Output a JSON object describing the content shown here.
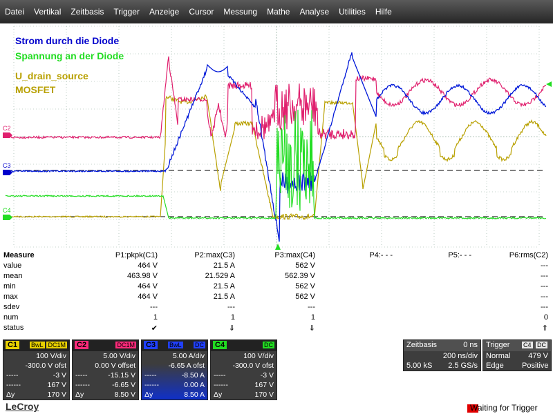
{
  "menu": [
    "Datei",
    "Vertikal",
    "Zeitbasis",
    "Trigger",
    "Anzeige",
    "Cursor",
    "Messung",
    "Mathe",
    "Analyse",
    "Utilities",
    "Hilfe"
  ],
  "legend": [
    {
      "text": "Strom durch die Diode",
      "color": "#0000cc"
    },
    {
      "text": "Spannung an der Diode",
      "color": "#22dd22"
    },
    {
      "text": "U_drain_source",
      "color": "#b8a000"
    },
    {
      "text": "MOSFET",
      "color": "#b8a000"
    }
  ],
  "channel_markers": [
    {
      "label": "C2",
      "color": "#e0206e"
    },
    {
      "label": "C3",
      "color": "#0000cc"
    },
    {
      "label": "C4",
      "color": "#22dd22"
    }
  ],
  "trigger_marker_color": "#22dd22",
  "colors": {
    "c1": "#b8a000",
    "c2": "#e0206e",
    "c3": "#0018d8",
    "c4": "#22dd22",
    "grid": "#7a9a8a"
  },
  "measure": {
    "header": [
      "Measure",
      "P1:pkpk(C1)",
      "P2:max(C3)",
      "P3:max(C4)",
      "P4:- - -",
      "P5:- - -",
      "P6:rms(C2)"
    ],
    "rows": [
      [
        "value",
        "464 V",
        "21.5 A",
        "562 V",
        "",
        "",
        "---"
      ],
      [
        "mean",
        "463.98 V",
        "21.529 A",
        "562.39 V",
        "",
        "",
        "---"
      ],
      [
        "min",
        "464 V",
        "21.5 A",
        "562 V",
        "",
        "",
        "---"
      ],
      [
        "max",
        "464 V",
        "21.5 A",
        "562 V",
        "",
        "",
        "---"
      ],
      [
        "sdev",
        "---",
        "---",
        "---",
        "",
        "",
        "---"
      ],
      [
        "num",
        "1",
        "1",
        "1",
        "",
        "",
        "0"
      ],
      [
        "status",
        "✔",
        "⇓",
        "⇓",
        "",
        "",
        "⇑"
      ]
    ]
  },
  "channels": [
    {
      "id": "C1",
      "badge1": "BwL",
      "badge2": "DC1M",
      "color": "#e8d000",
      "line1": "100 V/div",
      "line2": "-300.0 V ofst",
      "line3": [
        "-----",
        "-3 V"
      ],
      "line4": [
        "------",
        "167 V"
      ],
      "line5": [
        "Δy",
        "170 V"
      ]
    },
    {
      "id": "C2",
      "badge1": "",
      "badge2": "DC1M",
      "color": "#ff2a7a",
      "line1": "5.00 V/div",
      "line2": "0.00 V offset",
      "line3": [
        "-----",
        "-15.15 V"
      ],
      "line4": [
        "------",
        "-6.65 V"
      ],
      "line5": [
        "Δy",
        "8.50 V"
      ]
    },
    {
      "id": "C3",
      "badge1": "BwL",
      "badge2": "DC",
      "color": "#2040ff",
      "line1": "5.00 A/div",
      "line2": "-6.65 A ofst",
      "line3": [
        "-----",
        "-8.50 A"
      ],
      "line4": [
        "------",
        "0.00 A"
      ],
      "line5": [
        "Δy",
        "8.50 A"
      ]
    },
    {
      "id": "C4",
      "badge1": "",
      "badge2": "DC",
      "color": "#22dd22",
      "line1": "100 V/div",
      "line2": "-300.0 V ofst",
      "line3": [
        "-----",
        "-3 V"
      ],
      "line4": [
        "------",
        "167 V"
      ],
      "line5": [
        "Δy",
        "170 V"
      ]
    }
  ],
  "timebase": {
    "title": "Zeitbasis",
    "delay": "0 ns",
    "div": "200 ns/div",
    "samples": "5.00 kS",
    "rate": "2.5 GS/s"
  },
  "trigger": {
    "title": "Trigger",
    "ch": "C4",
    "coupling": "DC",
    "mode": "Normal",
    "level": "479 V",
    "type": "Edge",
    "slope": "Positive"
  },
  "brand": "LeCroy",
  "status": "Waiting for Trigger"
}
